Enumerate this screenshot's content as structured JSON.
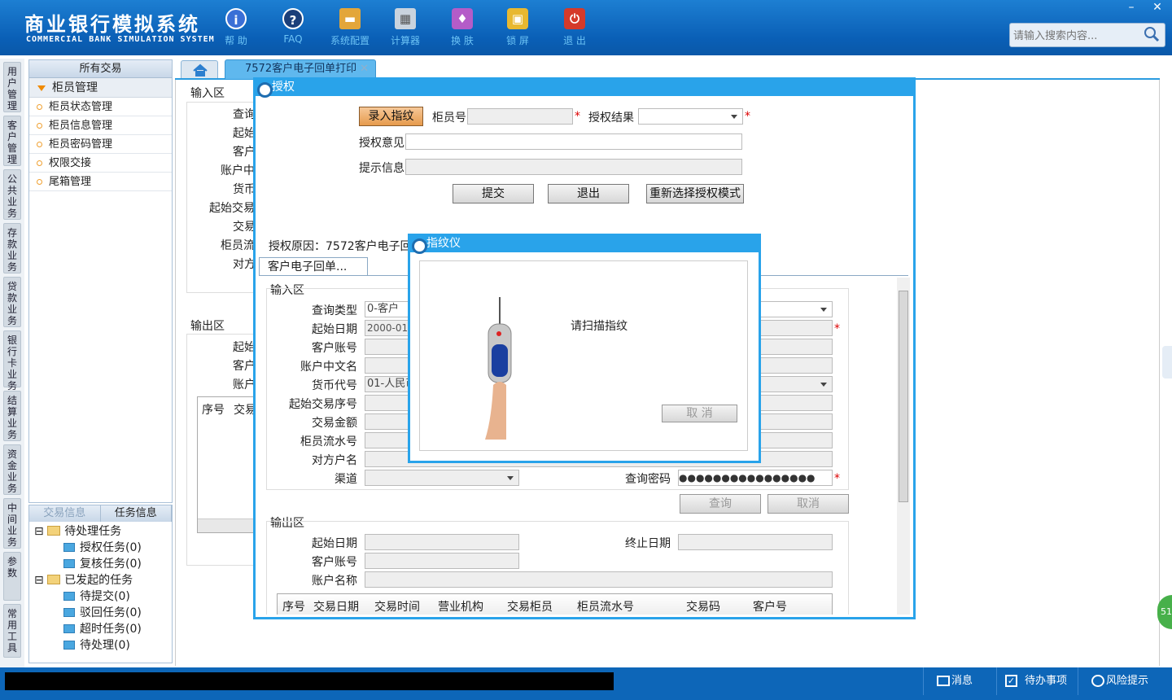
{
  "app": {
    "title_cn": "商业银行模拟系统",
    "title_en": "COMMERCIAL BANK SIMULATION SYSTEM"
  },
  "toolbar": [
    {
      "label": "帮 助",
      "icon": "info-icon"
    },
    {
      "label": "FAQ",
      "icon": "question-icon"
    },
    {
      "label": "系统配置",
      "icon": "toolbox-icon"
    },
    {
      "label": "计算器",
      "icon": "calculator-icon"
    },
    {
      "label": "换 肤",
      "icon": "shirt-icon"
    },
    {
      "label": "锁 屏",
      "icon": "lock-icon"
    },
    {
      "label": "退 出",
      "icon": "power-icon"
    }
  ],
  "search": {
    "placeholder": "请输入搜索内容..."
  },
  "window_controls": {
    "minimize": "–",
    "close": "✕"
  },
  "vtabs": [
    "用户管理",
    "客户管理",
    "公共业务",
    "存款业务",
    "贷款业务",
    "银行卡业务",
    "结算业务",
    "资金业务",
    "中间业务",
    "参数",
    "常用工具"
  ],
  "leftnav": {
    "header": "所有交易",
    "group": "柜员管理",
    "items": [
      "柜员状态管理",
      "柜员信息管理",
      "柜员密码管理",
      "权限交接",
      "尾箱管理"
    ]
  },
  "taskpanel": {
    "tabs": [
      "交易信息",
      "任务信息"
    ],
    "pending": {
      "label": "待处理任务",
      "children": [
        "授权任务(0)",
        "复核任务(0)"
      ]
    },
    "initiated": {
      "label": "已发起的任务",
      "children": [
        "待提交(0)",
        "驳回任务(0)",
        "超时任务(0)",
        "待处理(0)"
      ]
    }
  },
  "tabs": {
    "active": "7572客户电子回单打印",
    "close": "✕"
  },
  "background": {
    "input_section": "输入区",
    "input_labels": [
      "查询",
      "起始",
      "客户",
      "账户中",
      "货币",
      "起始交易",
      "交易",
      "柜员流",
      "对方"
    ],
    "output_section": "输出区",
    "output_labels": [
      "起始",
      "客户",
      "账户"
    ],
    "table_headers": [
      "序号",
      "交易"
    ]
  },
  "auth_dialog": {
    "title": "授权",
    "fingerprint_button": "录入指纹",
    "teller_label": "柜员号",
    "result_label": "授权结果",
    "opinion_label": "授权意见",
    "hint_label": "提示信息",
    "submit": "提交",
    "exit": "退出",
    "reselect": "重新选择授权模式",
    "reason": "授权原因：7572客户电子回单",
    "subtab": "客户电子回单...",
    "input_section": "输入区",
    "fields": {
      "query_type": {
        "label": "查询类型",
        "value": "0-客户"
      },
      "start_date": {
        "label": "起始日期",
        "value": "2000-01-"
      },
      "account_no": {
        "label": "客户账号"
      },
      "account_name_cn": {
        "label": "账户中文名"
      },
      "currency": {
        "label": "货币代号",
        "value": "01-人民币"
      },
      "start_seq": {
        "label": "起始交易序号"
      },
      "amount": {
        "label": "交易金额"
      },
      "teller_serial": {
        "label": "柜员流水号"
      },
      "counterparty": {
        "label": "对方户名"
      },
      "channel": {
        "label": "渠道"
      },
      "query_password": {
        "label": "查询密码",
        "value": "●●●●●●●●●●●●●●●●"
      }
    },
    "query_button": "查询",
    "cancel_button": "取消",
    "output_section": "输出区",
    "output_fields": {
      "start_date": "起始日期",
      "end_date": "终止日期",
      "account_no": "客户账号",
      "account_name": "账户名称"
    },
    "table_headers": [
      "序号",
      "交易日期",
      "交易时间",
      "营业机构",
      "交易柜员",
      "柜员流水号",
      "交易码",
      "客户号"
    ]
  },
  "fingerprint_dialog": {
    "title": "指纹仪",
    "prompt": "请扫描指纹",
    "cancel": "取 消"
  },
  "statusbar": {
    "message": "消息",
    "todo": "待办事项",
    "risk": "风险提示"
  },
  "float_badge": "51"
}
